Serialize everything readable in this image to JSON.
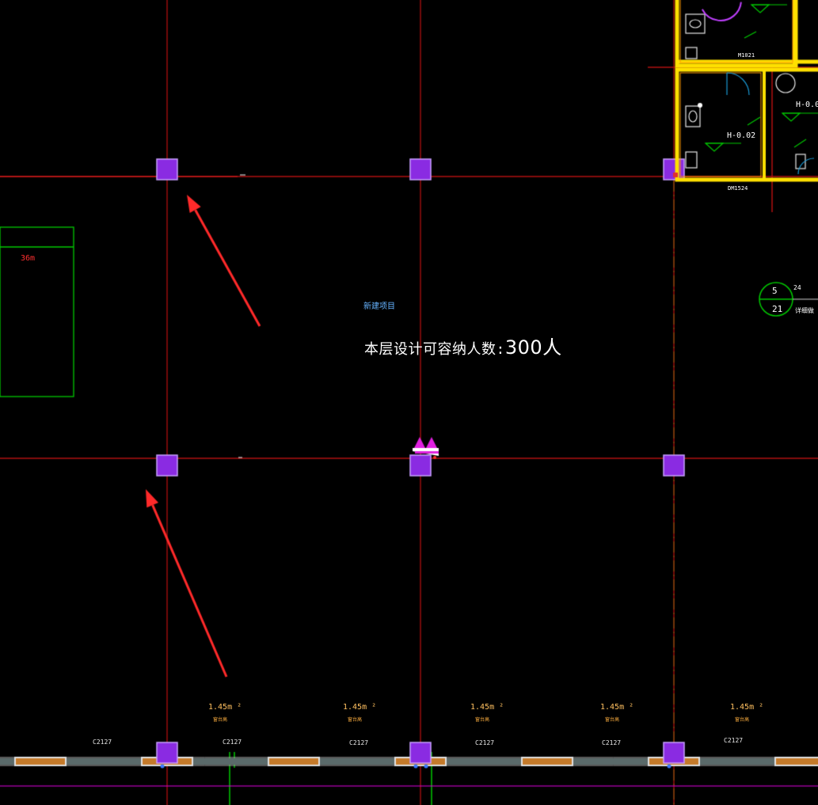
{
  "labels": {
    "capacity_prefix": "本层设计可容纳人数:",
    "capacity_value": "300人",
    "small_label": "新建项目",
    "area_label": "36m",
    "level_room1": "H-0.02",
    "level_room2": "H-0.0",
    "door_top": "M1021",
    "door_bottom": "DM1524",
    "index_top": "5",
    "index_bottom": "21",
    "index_note1": "24 ",
    "index_note2": "详细做",
    "elevation_sub": "窗台高"
  },
  "elevations": [
    "1.45m",
    "1.45m",
    "1.45m",
    "1.45m",
    "1.45m"
  ],
  "windows": [
    "C2127",
    "C2127",
    "C2127",
    "C2127",
    "C2127",
    "C2127"
  ],
  "colors": {
    "background": "#000000",
    "axis_line": "#b01010",
    "column_fill": "#8a2be2",
    "column_border": "#c8a0ff",
    "wall_yellow": "#ffe000",
    "green_line": "#00c800",
    "magenta_line": "#e000e0",
    "window_bar": "#c47a2a",
    "arrow": "#ff2a2a"
  }
}
